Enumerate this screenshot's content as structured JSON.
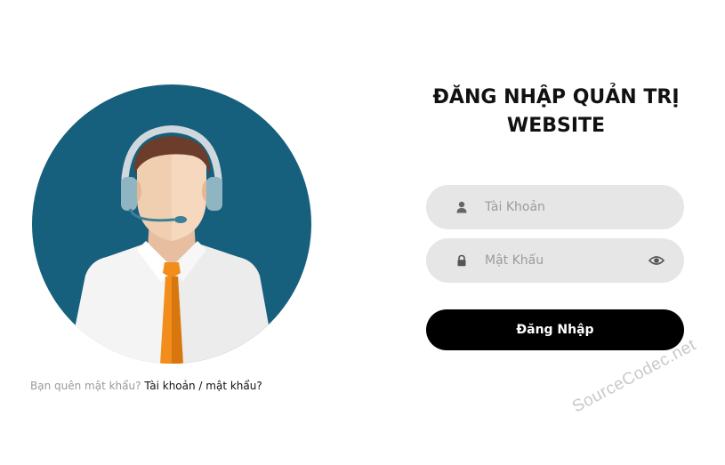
{
  "login": {
    "title_line1": "ĐĂNG NHẬP QUẢN TRỊ",
    "title_line2": "WEBSITE",
    "username_placeholder": "Tài Khoản",
    "password_placeholder": "Mật Khẩu",
    "submit_label": "Đăng Nhập"
  },
  "forgot": {
    "prefix": "Bạn quên mật khẩu?",
    "link": "Tài khoản / mật khẩu?"
  },
  "watermark": "SourceCodec.net",
  "icons": {
    "username": "user-icon",
    "password": "lock-icon",
    "toggle": "eye-icon"
  },
  "colors": {
    "circle": "#17607d",
    "button": "#000000",
    "field_bg": "#e6e6e6",
    "tie": "#f28c1b"
  }
}
